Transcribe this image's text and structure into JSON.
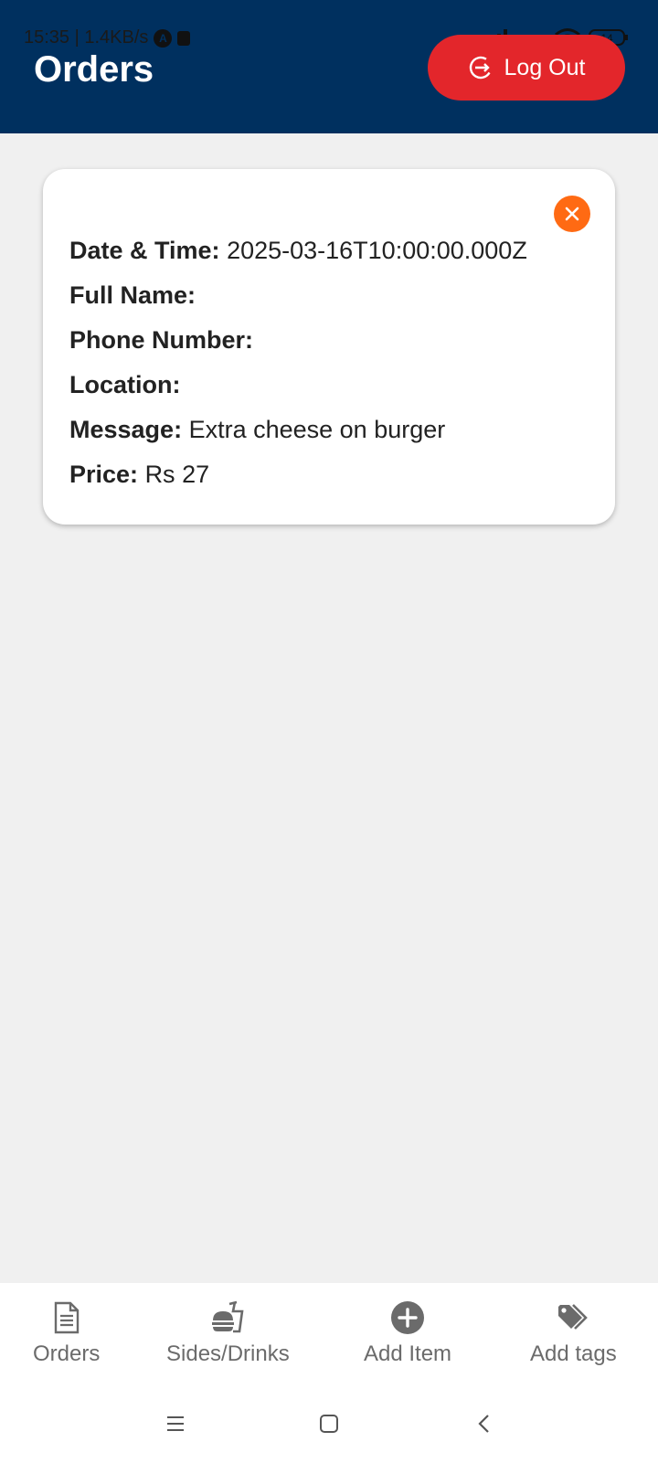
{
  "status_bar": {
    "time_speed": "15:35 | 1.4KB/s",
    "battery": "14"
  },
  "header": {
    "title": "Orders",
    "logout_label": "Log Out"
  },
  "order": {
    "fields": [
      {
        "label": "Date & Time:",
        "value": "2025-03-16T10:00:00.000Z"
      },
      {
        "label": "Full Name:",
        "value": ""
      },
      {
        "label": "Phone Number:",
        "value": ""
      },
      {
        "label": "Location:",
        "value": ""
      },
      {
        "label": "Message:",
        "value": "Extra cheese on burger"
      },
      {
        "label": "Price:",
        "value": "Rs 27"
      }
    ]
  },
  "bottom_nav": {
    "items": [
      {
        "label": "Orders",
        "icon": "document-icon"
      },
      {
        "label": "Sides/Drinks",
        "icon": "fastfood-icon"
      },
      {
        "label": "Add Item",
        "icon": "add-circle-icon"
      },
      {
        "label": "Add tags",
        "icon": "tag-icon"
      }
    ]
  },
  "colors": {
    "header_bg": "#00305f",
    "logout_bg": "#e3262b",
    "close_bg": "#ff6a13",
    "page_bg": "#f0f0f0"
  }
}
